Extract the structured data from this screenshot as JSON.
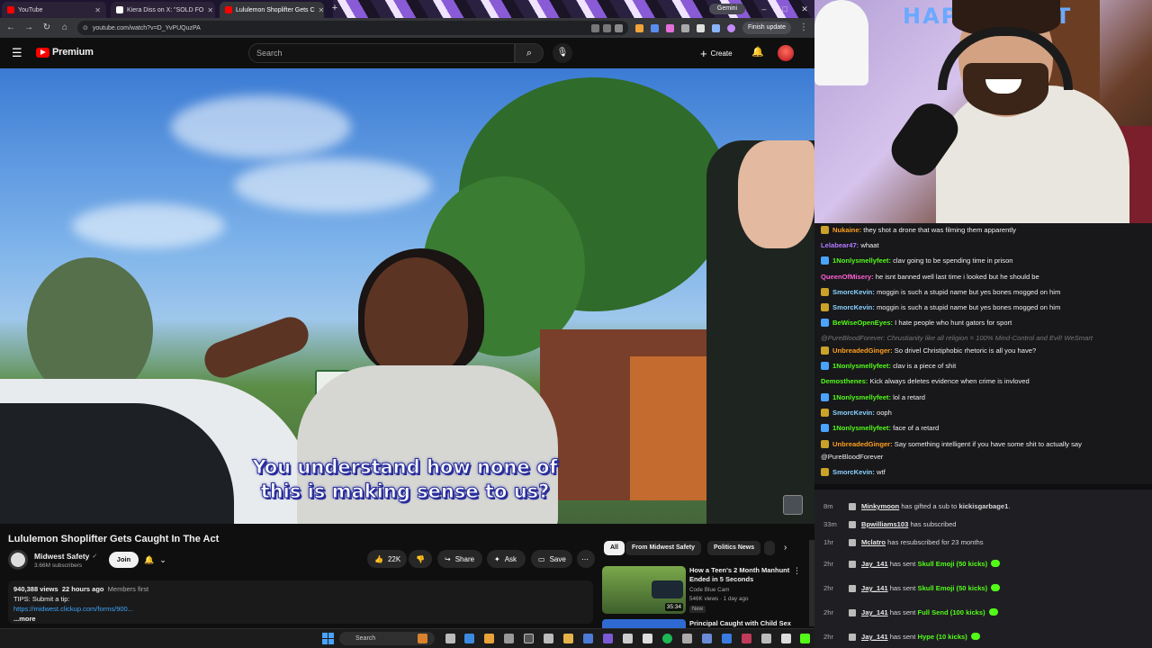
{
  "tabs": [
    {
      "label": "YouTube",
      "color": "#ff0000"
    },
    {
      "label": "Kiera Diss on X: \"SOLD FO",
      "color": "#ffffff"
    },
    {
      "label": "Lululemon Shoplifter Gets C",
      "color": "#ff0000"
    }
  ],
  "new_tab": "+",
  "gemini_label": "Gemini",
  "window_controls": [
    "–",
    "□",
    "✕"
  ],
  "address": {
    "url": "youtube.com/watch?v=D_YvPUQuzPA",
    "finish": "Finish update"
  },
  "nav": {
    "back": "←",
    "forward": "→",
    "reload": "↻",
    "home": "⌂"
  },
  "header": {
    "menu": "☰",
    "brand": "Premium",
    "search_placeholder": "Search",
    "search_icon": "⌕",
    "mic_icon": "🎙",
    "create_label": "Create",
    "create_plus": "+",
    "bell_icon": "🔔"
  },
  "video": {
    "subtitle_line1": "You understand how none of",
    "subtitle_line2": "this is making sense to us?"
  },
  "info": {
    "title": "Lululemon Shoplifter Gets Caught In The Act",
    "channel": "Midwest Safety",
    "verified": "✓",
    "subscribers": "3.66M subscribers",
    "join": "Join",
    "bell": "🔔",
    "chevron": "⌄",
    "likes": "22K",
    "like_icon": "👍",
    "dislike_icon": "👎",
    "share": "Share",
    "share_icon": "↪",
    "ask": "Ask",
    "ask_icon": "✦",
    "save": "Save",
    "save_icon": "▭",
    "more": "⋯"
  },
  "description": {
    "views": "940,388 views",
    "ago": "22 hours ago",
    "members": "Members first",
    "line2": "TIPS: Submit a tip:",
    "link": "https://midwest.clickup.com/forms/900...",
    "more": "...more"
  },
  "chips": [
    "All",
    "From Midwest Safety",
    "Politics News"
  ],
  "chip_next": "›",
  "related": [
    {
      "title": "How a Teen's 2 Month Manhunt Ended in 5 Seconds",
      "channel": "Code Blue Cam",
      "meta": "546K views · 1 day ago",
      "badge": "New",
      "duration": "35:34",
      "more": "⋮"
    },
    {
      "title": "Principal Caught with Child Sex"
    }
  ],
  "taskbar": {
    "search": "Search"
  },
  "stream": {
    "banner": "HAPPY EAST"
  },
  "chat": [
    {
      "name": "Nukaine:",
      "text": "they shot a drone that was filming them apparently",
      "color": "#ff9f1c",
      "badge": "#c9a227"
    },
    {
      "name": "Lelabear47:",
      "text": "whaat",
      "color": "#b37bff",
      "badge": ""
    },
    {
      "name": "1Nonlysmellyfeet:",
      "text": "clav going to be spending time in prison",
      "color": "#53fc18",
      "badge": "#4aa3ff"
    },
    {
      "name": "QueenOfMisery:",
      "text": "he isnt banned well last time i looked but he should be",
      "color": "#ff5fd2",
      "badge": ""
    },
    {
      "name": "SmorcKevin:",
      "text": "moggin is such a stupid name but yes bones mogged on him",
      "color": "#8ad1ff",
      "badge": "#c9a227"
    },
    {
      "name": "SmorcKevin:",
      "text": "moggin is such a stupid name but yes bones mogged on him",
      "color": "#8ad1ff",
      "badge": "#c9a227"
    },
    {
      "name": "BeWiseOpenEyes:",
      "text": "I hate people who hunt gators for sport",
      "color": "#53fc18",
      "badge": "#4aa3ff"
    },
    {
      "name": "",
      "text": "@PureBloodForever: Chrustianity like all religion = 100% Mind-Control and Evil! WeSmart",
      "color": "#777",
      "badge": ""
    },
    {
      "name": "UnbreadedGinger:",
      "text": "So drivel Christiphobic rhetoric is all you have?",
      "color": "#ff9f1c",
      "badge": "#c9a227"
    },
    {
      "name": "1Nonlysmellyfeet:",
      "text": "clav is a piece of shit",
      "color": "#53fc18",
      "badge": "#4aa3ff"
    },
    {
      "name": "Demosthenes:",
      "text": "Kick always deletes evidence when crime is invloved",
      "color": "#53fc18",
      "badge": ""
    },
    {
      "name": "1Nonlysmellyfeet:",
      "text": "lol a retard",
      "color": "#53fc18",
      "badge": "#4aa3ff"
    },
    {
      "name": "SmorcKevin:",
      "text": "ooph",
      "color": "#8ad1ff",
      "badge": "#c9a227"
    },
    {
      "name": "1Nonlysmellyfeet:",
      "text": "face of a retard",
      "color": "#53fc18",
      "badge": "#4aa3ff"
    },
    {
      "name": "UnbreadedGinger:",
      "text": "Say something intelligent if you have some shit to actually say",
      "color": "#ff9f1c",
      "badge": "#c9a227"
    },
    {
      "name": "",
      "text": "@PureBloodForever",
      "color": "#efeff1",
      "badge": ""
    },
    {
      "name": "SmorcKevin:",
      "text": "wtf",
      "color": "#8ad1ff",
      "badge": "#c9a227"
    }
  ],
  "events": [
    {
      "time": "8m",
      "user": "Minkymoon",
      "pre": " has gifted a sub to ",
      "highlight": "kickisgarbage1",
      "post": ".",
      "gift": false
    },
    {
      "time": "33m",
      "user": "Bpwilliams103",
      "pre": " has subscribed",
      "highlight": "",
      "post": "",
      "gift": false
    },
    {
      "time": "1hr",
      "user": "Mclatro",
      "pre": " has resubscribed for 23 months",
      "highlight": "",
      "post": "",
      "gift": false
    },
    {
      "time": "2hr",
      "user": "Jay_141",
      "pre": " has sent ",
      "highlight": "Skull Emoji (50 kicks)",
      "post": "",
      "gift": true
    },
    {
      "time": "2hr",
      "user": "Jay_141",
      "pre": " has sent ",
      "highlight": "Skull Emoji (50 kicks)",
      "post": "",
      "gift": true
    },
    {
      "time": "2hr",
      "user": "Jay_141",
      "pre": " has sent ",
      "highlight": "Full Send (100 kicks)",
      "post": "",
      "gift": true
    },
    {
      "time": "2hr",
      "user": "Jay_141",
      "pre": " has sent ",
      "highlight": "Hype (10 kicks)",
      "post": "",
      "gift": true
    }
  ]
}
